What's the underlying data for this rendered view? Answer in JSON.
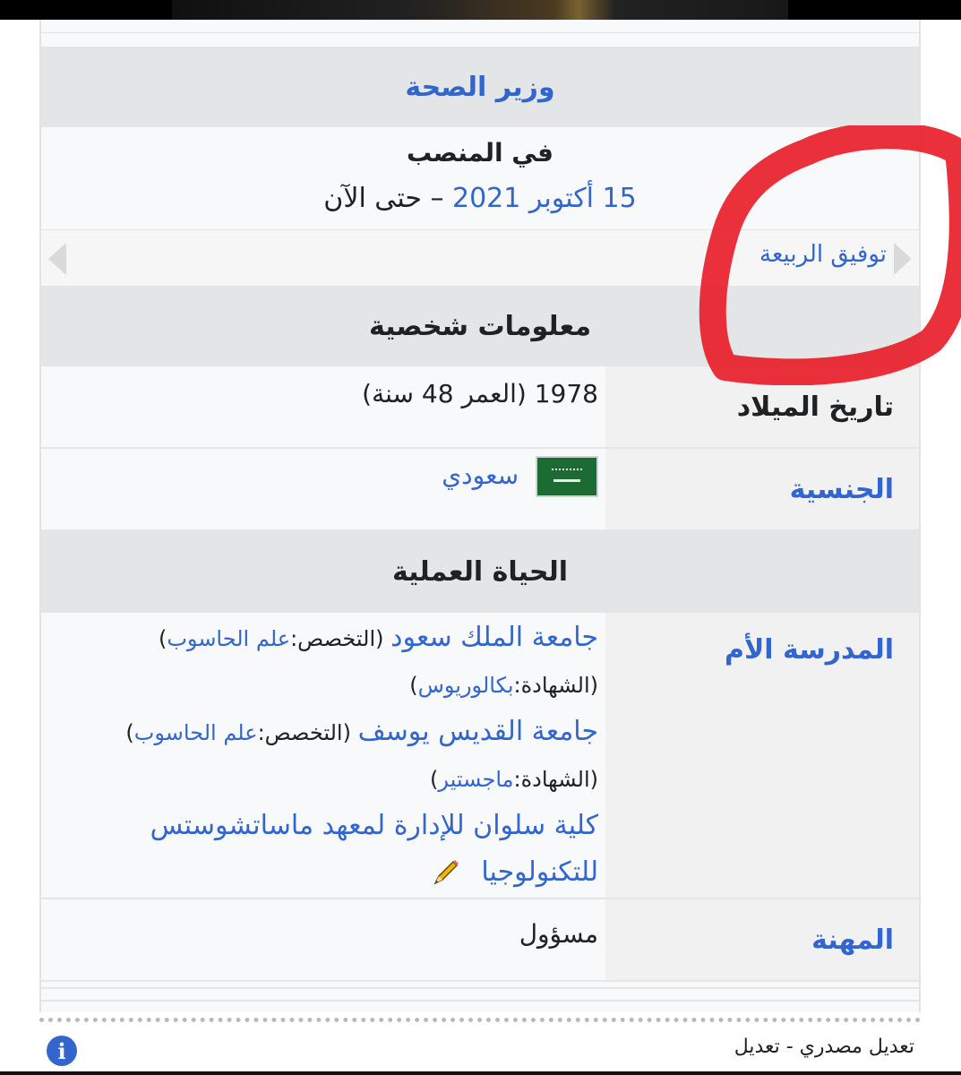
{
  "infobox": {
    "position_title": "وزير الصحة",
    "office_heading": "في المنصب",
    "office_start": "15 أكتوبر 2021",
    "office_end": " – حتى الآن",
    "predecessor": "توفيق الربيعة",
    "personal_info_heading": "معلومات شخصية",
    "birth_label": "تاريخ الميلاد",
    "birth_value": "1978 (العمر 48 سنة)",
    "nationality_label": "الجنسية",
    "nationality_value": "سعودي",
    "career_heading": "الحياة العملية",
    "alma_mater_label": "المدرسة الأم",
    "education": [
      {
        "school": "جامعة الملك سعود",
        "spec_prefix": " (التخصص:",
        "spec": "علم الحاسوب",
        "spec_suffix": ")",
        "degree_prefix": "(الشهادة:",
        "degree": "بكالوريوس",
        "degree_suffix": ")"
      },
      {
        "school": "جامعة القديس يوسف",
        "spec_prefix": " (التخصص:",
        "spec": "علم الحاسوب",
        "spec_suffix": ")",
        "degree_prefix": "(الشهادة:",
        "degree": "ماجستير",
        "degree_suffix": ")"
      }
    ],
    "school3_line1": "كلية سلوان للإدارة لمعهد ماساتشوستس",
    "school3_line2": "للتكنولوجيا",
    "occupation_label": "المهنة",
    "occupation_value": "مسؤول"
  },
  "footer": {
    "edit_links": "تعديل مصدري - تعديل",
    "info_icon_glyph": "i"
  },
  "colors": {
    "link": "#3366cc",
    "band": "#e4e5e7",
    "annotation": "#e8202a"
  },
  "icons": [
    "flag-icon",
    "pencil-icon",
    "info-icon",
    "arrow-left-icon",
    "arrow-right-icon"
  ]
}
